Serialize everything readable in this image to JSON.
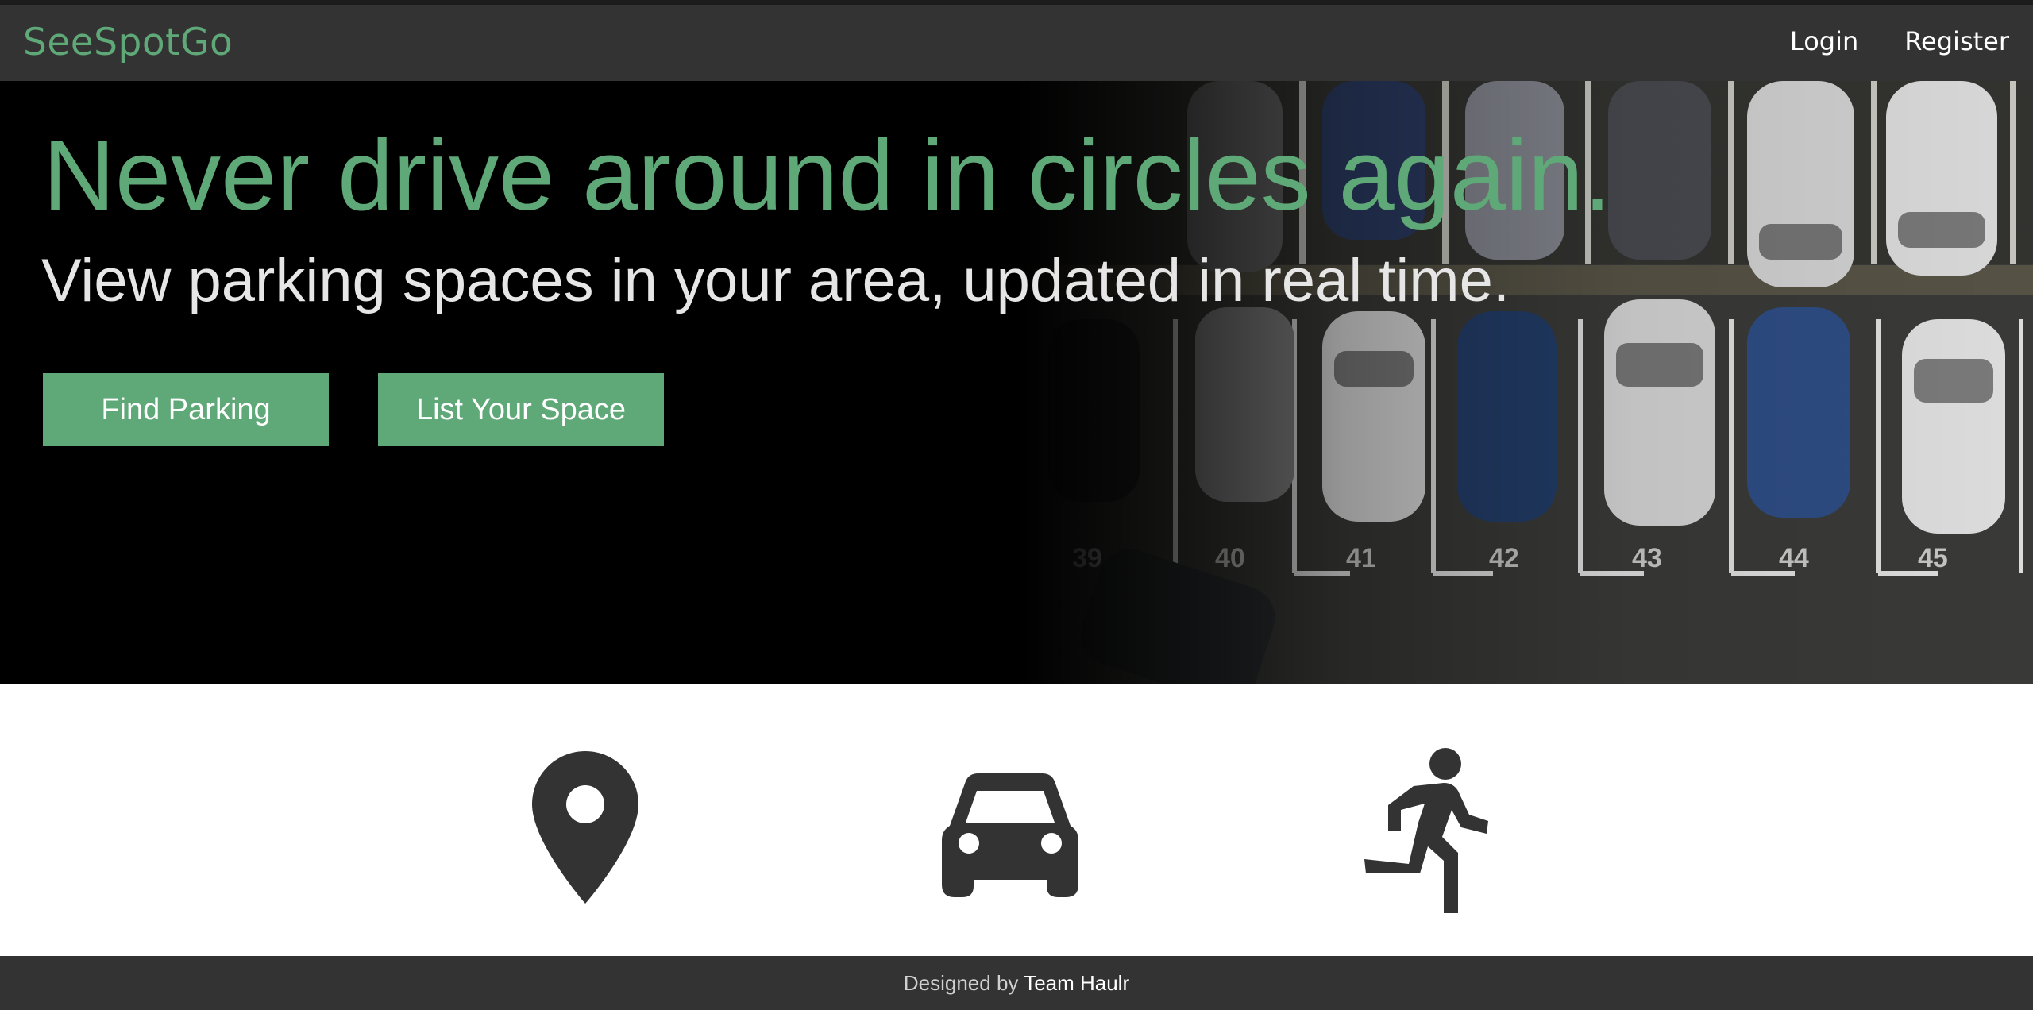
{
  "navbar": {
    "brand": "SeeSpotGo",
    "links": [
      {
        "label": "Login"
      },
      {
        "label": "Register"
      }
    ]
  },
  "hero": {
    "title": "Never drive around in circles again.",
    "subtitle": "View parking spaces in your area, updated in real time.",
    "buttons": {
      "find_parking": "Find Parking",
      "list_space": "List Your Space"
    },
    "background": "parking-lot-photo",
    "stall_numbers": [
      "39",
      "40",
      "41",
      "42",
      "43",
      "44",
      "45"
    ]
  },
  "features": {
    "icons": [
      "map-pin-icon",
      "car-icon",
      "walking-person-icon"
    ]
  },
  "footer": {
    "prefix": "Designed by",
    "team": "Team Haulr"
  },
  "colors": {
    "accent": "#5fa878",
    "bar": "#333333",
    "hero_bg": "#000000",
    "icon": "#333333"
  }
}
